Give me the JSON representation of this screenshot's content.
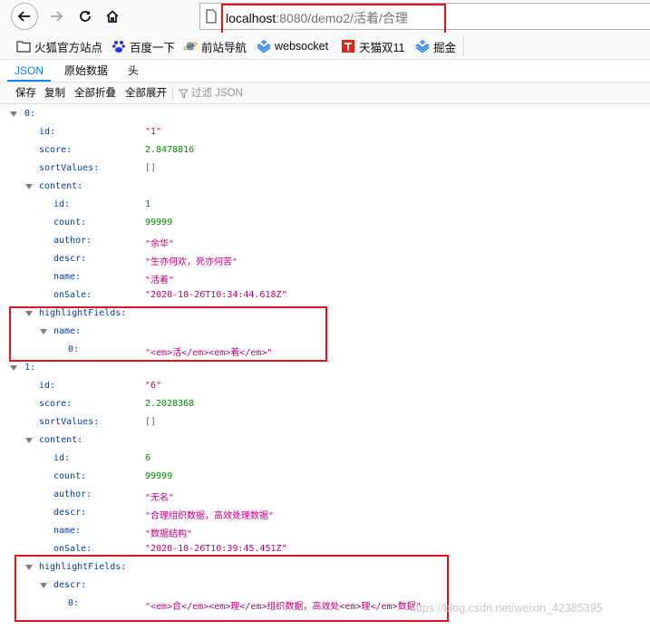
{
  "nav": {
    "url_host": "localhost",
    "url_rest": ":8080/demo2/活着/合理"
  },
  "bookmarks": [
    {
      "label": "火狐官方站点",
      "icon": "folder-icon"
    },
    {
      "label": "百度一下",
      "icon": "baidu-paw-icon"
    },
    {
      "label": "前站导航",
      "icon": "planet-icon"
    },
    {
      "label": "websocket",
      "icon": "juejin-icon"
    },
    {
      "label": "天猫双11",
      "icon": "tmall-icon"
    },
    {
      "label": "掘金",
      "icon": "juejin-icon"
    }
  ],
  "tabs": [
    "JSON",
    "原始数据",
    "头"
  ],
  "toolbar": {
    "save": "保存",
    "copy": "复制",
    "collapse_all": "全部折叠",
    "expand_all": "全部展开",
    "filter_placeholder": "过滤 JSON"
  },
  "tree": [
    {
      "key": "0:",
      "value": "",
      "type": "",
      "level": 0,
      "expandable": true
    },
    {
      "key": "id:",
      "value": "\"1\"",
      "type": "str",
      "level": 1
    },
    {
      "key": "score:",
      "value": "2.8478816",
      "type": "num",
      "level": 1
    },
    {
      "key": "sortValues:",
      "value": "[]",
      "type": "arr",
      "level": 1
    },
    {
      "key": "content:",
      "value": "",
      "type": "",
      "level": 1,
      "expandable": true
    },
    {
      "key": "id:",
      "value": "1",
      "type": "num",
      "level": 2
    },
    {
      "key": "count:",
      "value": "99999",
      "type": "num",
      "level": 2
    },
    {
      "key": "author:",
      "value": "\"余华\"",
      "type": "str",
      "level": 2
    },
    {
      "key": "descr:",
      "value": "\"生亦何欢，死亦何苦\"",
      "type": "str",
      "level": 2
    },
    {
      "key": "name:",
      "value": "\"活着\"",
      "type": "str",
      "level": 2
    },
    {
      "key": "onSale:",
      "value": "\"2020-10-26T10:34:44.618Z\"",
      "type": "str",
      "level": 2
    },
    {
      "key": "highlightFields:",
      "value": "",
      "type": "",
      "level": 1,
      "expandable": true
    },
    {
      "key": "name:",
      "value": "",
      "type": "",
      "level": 2,
      "expandable": true
    },
    {
      "key": "0:",
      "value": "\"<em>活</em><em>着</em>\"",
      "type": "str",
      "level": 3
    },
    {
      "key": "1:",
      "value": "",
      "type": "",
      "level": 0,
      "expandable": true
    },
    {
      "key": "id:",
      "value": "\"6\"",
      "type": "str",
      "level": 1
    },
    {
      "key": "score:",
      "value": "2.2028368",
      "type": "num",
      "level": 1
    },
    {
      "key": "sortValues:",
      "value": "[]",
      "type": "arr",
      "level": 1
    },
    {
      "key": "content:",
      "value": "",
      "type": "",
      "level": 1,
      "expandable": true
    },
    {
      "key": "id:",
      "value": "6",
      "type": "num",
      "level": 2
    },
    {
      "key": "count:",
      "value": "99999",
      "type": "num",
      "level": 2
    },
    {
      "key": "author:",
      "value": "\"无名\"",
      "type": "str",
      "level": 2
    },
    {
      "key": "descr:",
      "value": "\"合理组织数据，高效处理数据\"",
      "type": "str",
      "level": 2
    },
    {
      "key": "name:",
      "value": "\"数据结构\"",
      "type": "str",
      "level": 2
    },
    {
      "key": "onSale:",
      "value": "\"2020-10-26T10:39:45.451Z\"",
      "type": "str",
      "level": 2
    },
    {
      "key": "highlightFields:",
      "value": "",
      "type": "",
      "level": 1,
      "expandable": true
    },
    {
      "key": "descr:",
      "value": "",
      "type": "",
      "level": 2,
      "expandable": true
    },
    {
      "key": "0:",
      "value": "\"<em>合</em><em>理</em>组织数据，高效处<em>理</em>数据\"",
      "type": "str",
      "level": 3
    }
  ],
  "watermark": "https://blog.csdn.net/weixin_42385395",
  "colors": {
    "highlight_box": "#e0141e",
    "key": "#003eaa",
    "string": "#c1007c",
    "number": "#058b00",
    "active_tab": "#0a84ff"
  }
}
